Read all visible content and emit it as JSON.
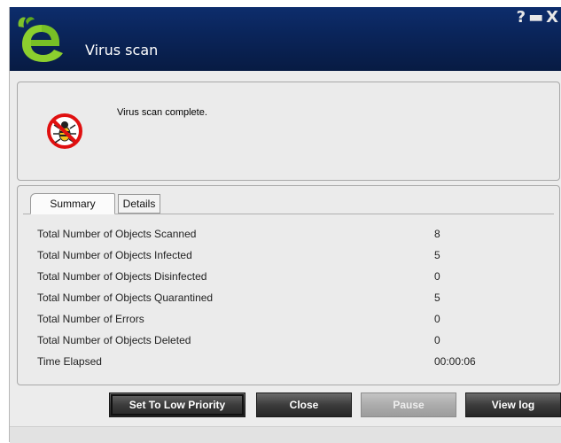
{
  "window": {
    "title": "Virus scan",
    "controls": {
      "help": "?",
      "minimize": "▬",
      "close": "X"
    },
    "logo_icon": "e-leaf-logo-icon"
  },
  "status": {
    "icon": "bug-blocked-icon",
    "message": "Virus scan complete."
  },
  "tabs": [
    {
      "label": "Summary",
      "active": true
    },
    {
      "label": "Details",
      "active": false
    }
  ],
  "summary": [
    {
      "label": "Total Number of Objects Scanned",
      "value": "8"
    },
    {
      "label": "Total Number of Objects Infected",
      "value": "5"
    },
    {
      "label": "Total Number of Objects Disinfected",
      "value": "0"
    },
    {
      "label": "Total Number of Objects Quarantined",
      "value": "5"
    },
    {
      "label": "Total Number of Errors",
      "value": "0"
    },
    {
      "label": "Total Number of Objects Deleted",
      "value": "0"
    },
    {
      "label": "Time Elapsed",
      "value": "00:00:06"
    }
  ],
  "buttons": {
    "low_priority": "Set To Low Priority",
    "close": "Close",
    "pause": "Pause",
    "view_log": "View log"
  },
  "colors": {
    "titlebar": "#0a2459",
    "button": "#3c3c3c",
    "button_disabled": "#acacac",
    "alert_red": "#e01010"
  }
}
